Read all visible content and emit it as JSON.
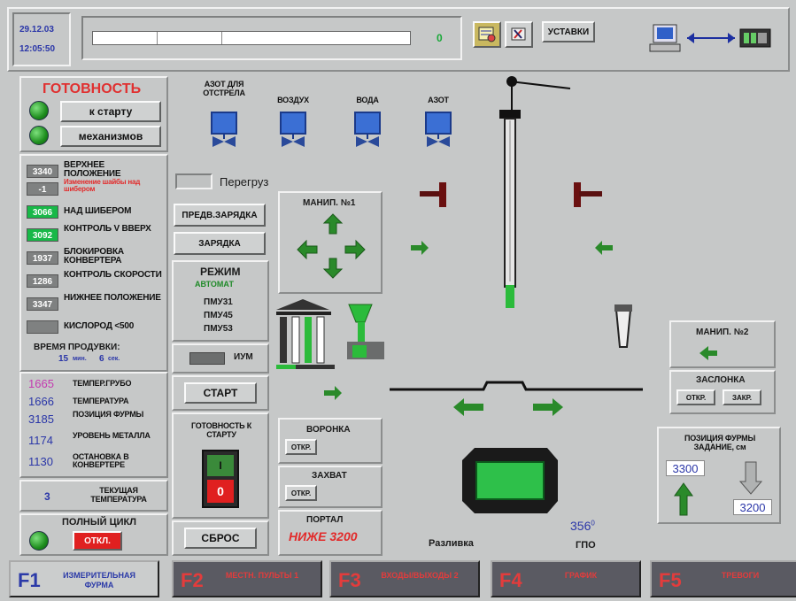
{
  "header": {
    "date": "29.12.03",
    "time": "12:05:50",
    "progress_value": "0",
    "ustavki_label": "УСТАВКИ"
  },
  "readiness": {
    "title": "ГОТОВНОСТЬ",
    "btn_start": "к старту",
    "btn_mech": "механизмов"
  },
  "params": [
    {
      "value": "3340",
      "label": "ВЕРХНЕЕ ПОЛОЖЕНИЕ"
    },
    {
      "value": "-1",
      "label": "Изменение шайбы над шибером"
    },
    {
      "value": "3066",
      "label": "НАД ШИБЕРОМ"
    },
    {
      "value": "3092",
      "label": "КОНТРОЛЬ V ВВЕРХ"
    },
    {
      "value": "1937",
      "label": "БЛОКИРОВКА КОНВЕРТЕРА"
    },
    {
      "value": "1286",
      "label": "КОНТРОЛЬ СКОРОСТИ"
    },
    {
      "value": "3347",
      "label": "НИЖНЕЕ ПОЛОЖЕНИЕ"
    },
    {
      "value": "",
      "label": "КИСЛОРОД <500"
    }
  ],
  "purge": {
    "title": "ВРЕМЯ ПРОДУВКИ:",
    "minutes": "15",
    "min_unit": "мин.",
    "seconds": "6",
    "sec_unit": "сек."
  },
  "temps": [
    {
      "value": "1665",
      "label": "ТЕМПЕР.ГРУБО",
      "color": "#c43ab0"
    },
    {
      "value": "1666",
      "label": "ТЕМПЕРАТУРА",
      "color": "#2a36a8"
    },
    {
      "value": "3185",
      "label": "ПОЗИЦИЯ ФУРМЫ",
      "color": "#2a36a8"
    },
    {
      "value": "1174",
      "label": "УРОВЕНЬ МЕТАЛЛА",
      "color": "#2a36a8"
    },
    {
      "value": "1130",
      "label": "ОСТАНОВКА В КОНВЕРТЕРЕ",
      "color": "#2a36a8"
    }
  ],
  "current_temp": {
    "value": "3",
    "label": "ТЕКУЩАЯ ТЕМПЕРАТУРА"
  },
  "full_cycle": {
    "label": "ПОЛНЫЙ ЦИКЛ",
    "btn": "ОТКЛ."
  },
  "overload_label": "Перегруз",
  "controls": {
    "pre_charge": "ПРЕДВ.ЗАРЯДКА",
    "charge": "ЗАРЯДКА",
    "mode_title": "РЕЖИМ",
    "mode_value": "АВТОМАТ",
    "pmu": [
      "ПМУ31",
      "ПМУ45",
      "ПМУ53"
    ],
    "ium": "ИУМ",
    "start": "СТАРТ",
    "ready_label": "ГОТОВНОСТЬ К СТАРТУ",
    "switch_top": "I",
    "switch_bottom": "0",
    "reset": "СБРОС"
  },
  "valves": [
    "АЗОТ ДЛЯ ОТСТРЕЛА",
    "ВОЗДУХ",
    "ВОДА",
    "АЗОТ"
  ],
  "manip1": "МАНИП. №1",
  "manip2": "МАНИП. №2",
  "funnel": {
    "label": "ВОРОНКА",
    "btn": "ОТКР."
  },
  "grab": {
    "label": "ЗАХВАТ",
    "btn": "ОТКР."
  },
  "portal": {
    "label": "ПОРТАЛ",
    "value": "НИЖЕ 3200"
  },
  "damper": {
    "label": "ЗАСЛОНКА",
    "open": "ОТКР.",
    "close": "ЗАКР."
  },
  "lance": {
    "title": "ПОЗИЦИЯ ФУРМЫ ЗАДАНИЕ, см",
    "up_value": "3300",
    "down_value": "3200"
  },
  "casting_label": "Разливка",
  "gpo": {
    "value": "356",
    "sup": "0",
    "label": "ГПО"
  },
  "fkeys": [
    {
      "key": "F1",
      "label": "ИЗМЕРИТЕЛЬНАЯ ФУРМА"
    },
    {
      "key": "F2",
      "label": "МЕСТН. ПУЛЬТЫ 1"
    },
    {
      "key": "F3",
      "label": "ВХОДЫ/ВЫХОДЫ 2"
    },
    {
      "key": "F4",
      "label": "ГРАФИК"
    },
    {
      "key": "F5",
      "label": "ТРЕВОГИ"
    }
  ],
  "colors": {
    "accent_blue": "#2a36a8",
    "alarm_red": "#e22a2a",
    "ok_green": "#18b848",
    "valve_blue": "#3b6fd4"
  }
}
